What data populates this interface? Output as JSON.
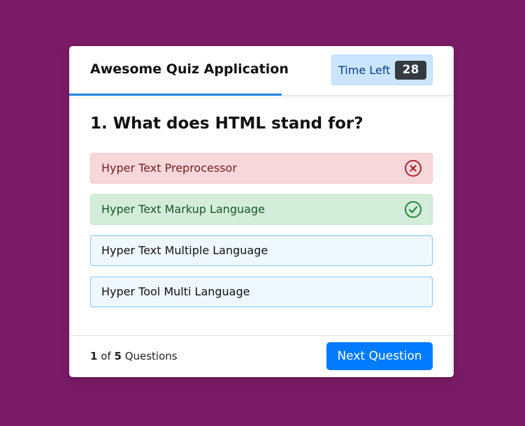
{
  "header": {
    "title": "Awesome Quiz Application",
    "timer_label": "Time Left",
    "timer_value": "28"
  },
  "question": {
    "text": "1. What does HTML stand for?"
  },
  "options": [
    {
      "label": "Hyper Text Preprocessor",
      "state": "incorrect",
      "icon": "x-circle-icon"
    },
    {
      "label": "Hyper Text Markup Language",
      "state": "correct",
      "icon": "check-circle-icon"
    },
    {
      "label": "Hyper Text Multiple Language",
      "state": "disabled",
      "icon": ""
    },
    {
      "label": "Hyper Tool Multi Language",
      "state": "disabled",
      "icon": ""
    }
  ],
  "footer": {
    "current": "1",
    "of_label": "of",
    "total": "5",
    "questions_label": "Questions",
    "next_label": "Next Question"
  },
  "colors": {
    "background": "#7a1b66",
    "accent": "#1e88e5",
    "button": "#007bff",
    "incorrect": "#721c24",
    "correct": "#155724"
  }
}
